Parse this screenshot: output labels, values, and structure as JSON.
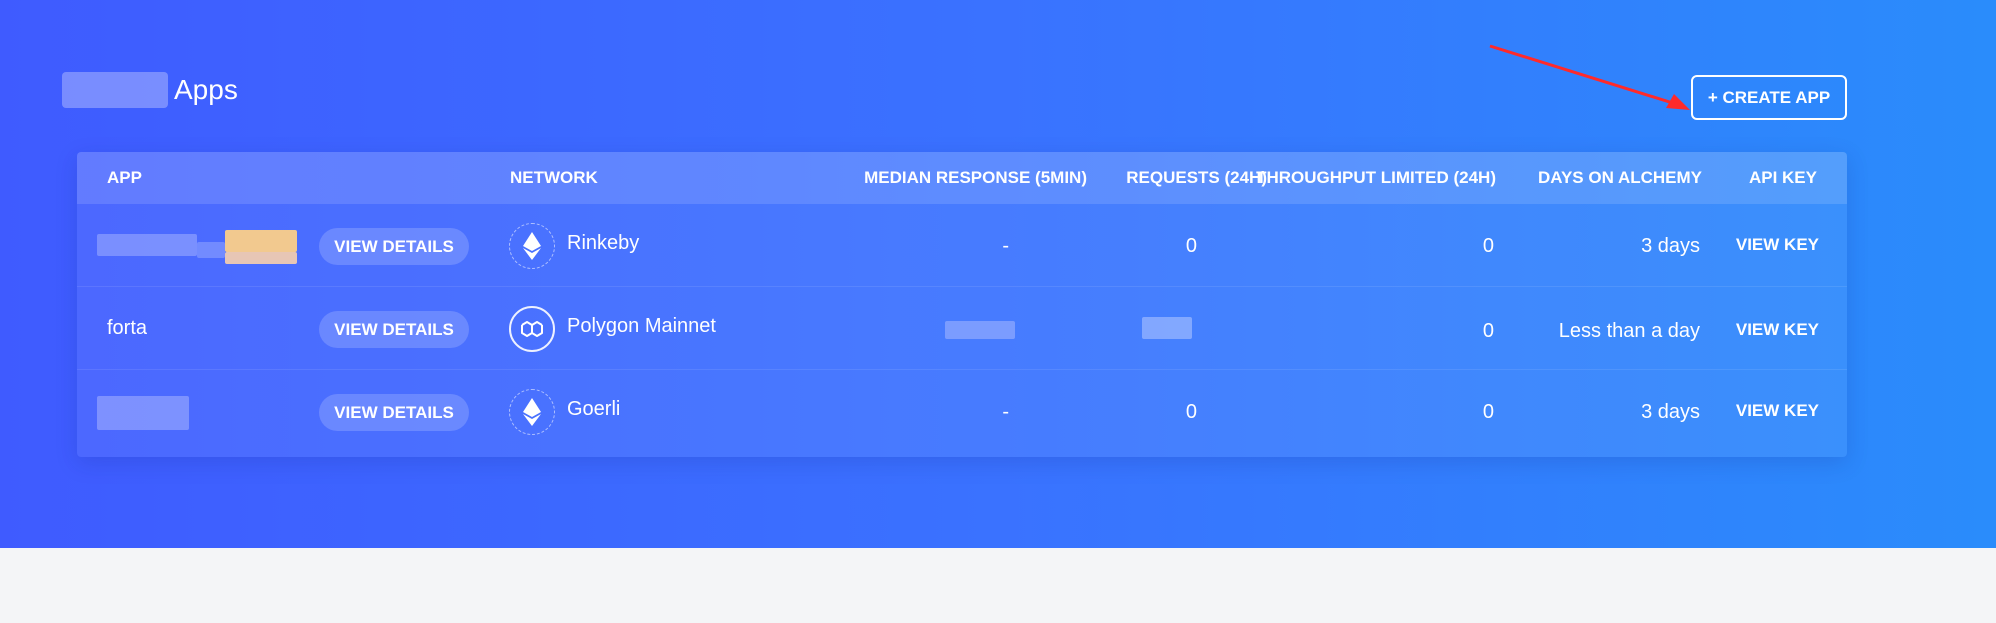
{
  "page": {
    "title": "Apps",
    "create_button": "+ CREATE APP"
  },
  "table": {
    "columns": {
      "app": "APP",
      "network": "NETWORK",
      "median": "MEDIAN RESPONSE (5MIN)",
      "requests": "REQUESTS (24H)",
      "throughput": "THROUGHPUT LIMITED (24H)",
      "days": "DAYS ON ALCHEMY",
      "apikey": "API KEY"
    },
    "rows": [
      {
        "name": "",
        "details": "VIEW DETAILS",
        "network": "Rinkeby",
        "network_icon": "ethereum-icon",
        "median": "-",
        "requests": "0",
        "throughput": "0",
        "days": "3 days",
        "key": "VIEW KEY"
      },
      {
        "name": "forta",
        "details": "VIEW DETAILS",
        "network": "Polygon Mainnet",
        "network_icon": "polygon-icon",
        "median": "",
        "requests": "",
        "throughput": "0",
        "days": "Less than a day",
        "key": "VIEW KEY"
      },
      {
        "name": "",
        "details": "VIEW DETAILS",
        "network": "Goerli",
        "network_icon": "ethereum-icon",
        "median": "-",
        "requests": "0",
        "throughput": "0",
        "days": "3 days",
        "key": "VIEW KEY"
      }
    ]
  },
  "colors": {
    "gradient_start": "#3f5bff",
    "gradient_end": "#2a8cfb",
    "arrow": "#ff2a2a"
  }
}
